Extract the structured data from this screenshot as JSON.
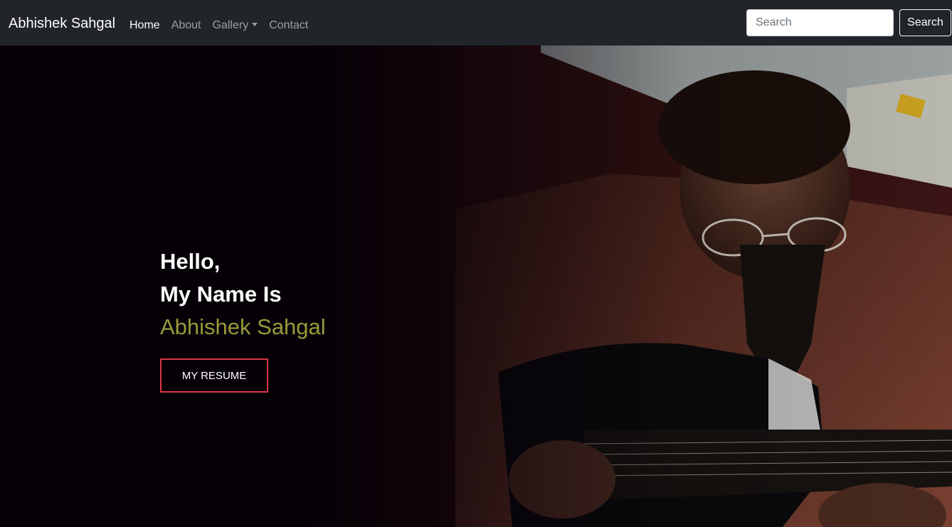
{
  "navbar": {
    "brand": "Abhishek Sahgal",
    "links": [
      {
        "label": "Home",
        "active": true
      },
      {
        "label": "About",
        "active": false
      },
      {
        "label": "Gallery",
        "active": false
      },
      {
        "label": "Contact",
        "active": false
      }
    ],
    "search": {
      "placeholder": "Search",
      "value": "",
      "button_label": "Search"
    }
  },
  "hero": {
    "greeting": "Hello,",
    "intro": "My Name Is",
    "name": "Abhishek Sahgal",
    "button_label": "MY RESUME"
  },
  "colors": {
    "navbar_bg": "#212529",
    "name_accent": "#9a9a3a",
    "button_border": "#dc3545"
  }
}
